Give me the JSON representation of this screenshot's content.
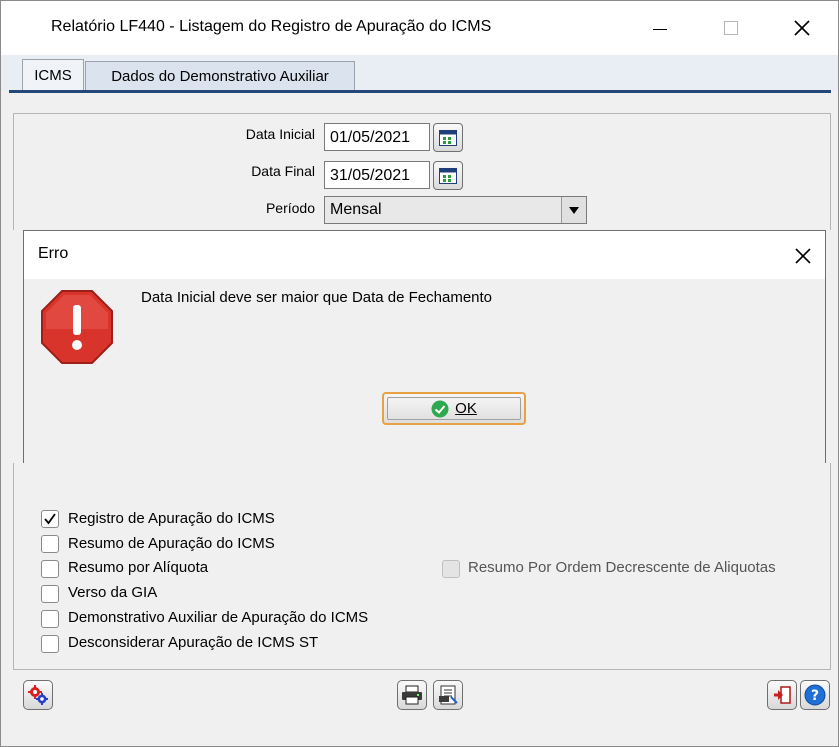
{
  "window": {
    "title": "Relatório LF440 - Listagem do Registro de Apuração do ICMS",
    "minimize_icon": "minimize-icon",
    "maximize_icon": "maximize-icon",
    "close_icon": "close-icon"
  },
  "tabs": [
    {
      "label": "ICMS",
      "active": true
    },
    {
      "label": "Dados do Demonstrativo Auxiliar",
      "active": false
    }
  ],
  "form": {
    "data_inicial_label": "Data Inicial",
    "data_inicial_value": "01/05/2021",
    "data_final_label": "Data Final",
    "data_final_value": "31/05/2021",
    "periodo_label": "Período",
    "periodo_value": "Mensal"
  },
  "dialog": {
    "title": "Erro",
    "message": "Data Inicial deve ser maior que Data de Fechamento",
    "ok_label": "OK",
    "icon": "error-stop-icon"
  },
  "checkboxes": [
    {
      "label": "Registro de Apuração do ICMS",
      "checked": true
    },
    {
      "label": "Resumo de Apuração do ICMS",
      "checked": false
    },
    {
      "label": "Resumo por Alíquota",
      "checked": false
    },
    {
      "label": "Verso da GIA",
      "checked": false
    },
    {
      "label": "Demonstrativo Auxiliar de Apuração do ICMS",
      "checked": false
    },
    {
      "label": "Desconsiderar Apuração de ICMS ST",
      "checked": false
    }
  ],
  "extra_checkbox": {
    "label": "Resumo Por Ordem Decrescente de Aliquotas",
    "checked": false,
    "disabled": true
  },
  "toolbar": {
    "left": "gears-icon",
    "center": [
      "printer-icon",
      "print-setup-icon"
    ],
    "right": [
      "exit-icon",
      "help-icon"
    ]
  },
  "colors": {
    "accent": "#25487a",
    "ok_focus": "#e8a243",
    "error_red": "#d9342b"
  }
}
